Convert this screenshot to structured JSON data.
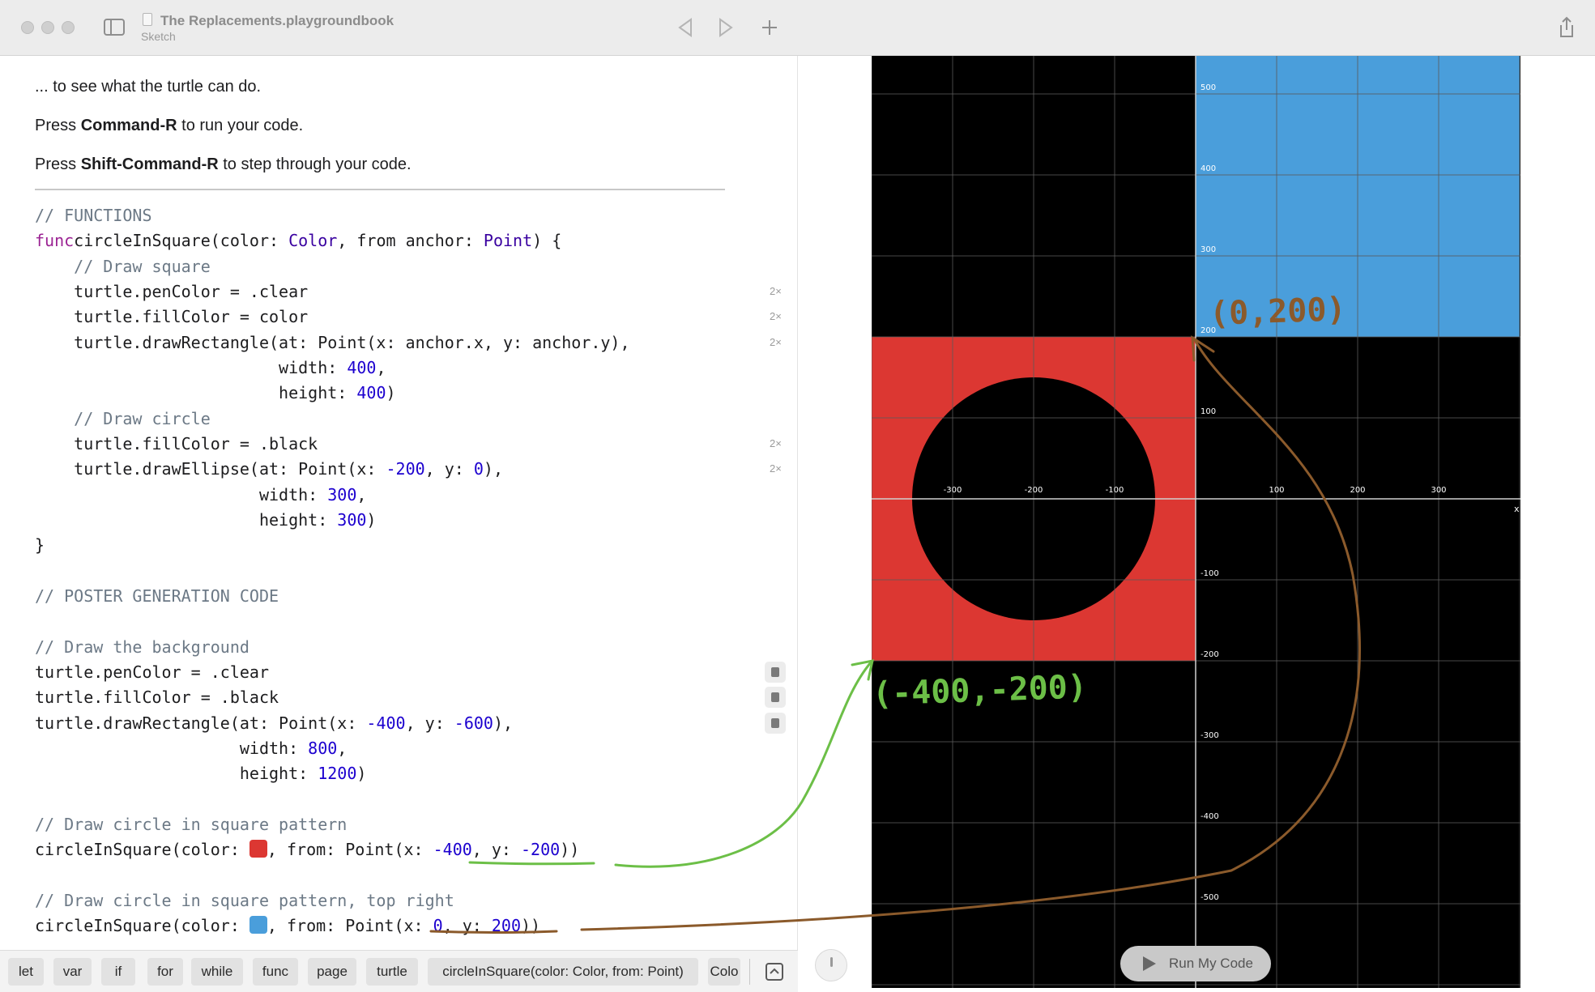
{
  "window": {
    "title": "The Replacements.playgroundbook",
    "subtitle": "Sketch"
  },
  "prose": {
    "line1": "... to see what the turtle can do.",
    "line2_pre": "Press ",
    "line2_bold": "Command-R",
    "line2_post": " to run your code.",
    "line3_pre": "Press ",
    "line3_bold": "Shift-Command-R",
    "line3_post": " to step through your code."
  },
  "code": [
    [
      [
        "cm",
        "// FUNCTIONS"
      ]
    ],
    [
      [
        "kw",
        "func"
      ],
      [
        "",
        "circleInSquare(color: "
      ],
      [
        "ty",
        "Color"
      ],
      [
        "",
        ", from anchor: "
      ],
      [
        "ty",
        "Point"
      ],
      [
        "",
        ") {"
      ]
    ],
    [
      [
        "",
        "    "
      ],
      [
        "cm",
        "// Draw square"
      ]
    ],
    [
      [
        "",
        "    turtle.penColor = .clear"
      ]
    ],
    [
      [
        "",
        "    turtle.fillColor = color"
      ]
    ],
    [
      [
        "",
        "    turtle.drawRectangle(at: Point(x: anchor.x, y: anchor.y),"
      ]
    ],
    [
      [
        "",
        "                         width: "
      ],
      [
        "nu",
        "400"
      ],
      [
        "",
        ","
      ]
    ],
    [
      [
        "",
        "                         height: "
      ],
      [
        "nu",
        "400"
      ],
      [
        "",
        ")"
      ]
    ],
    [
      [
        "",
        "    "
      ],
      [
        "cm",
        "// Draw circle"
      ]
    ],
    [
      [
        "",
        "    turtle.fillColor = .black"
      ]
    ],
    [
      [
        "",
        "    turtle.drawEllipse(at: Point(x: "
      ],
      [
        "nu",
        "-200"
      ],
      [
        "",
        ", y: "
      ],
      [
        "nu",
        "0"
      ],
      [
        "",
        "),"
      ]
    ],
    [
      [
        "",
        "                       width: "
      ],
      [
        "nu",
        "300"
      ],
      [
        "",
        ","
      ]
    ],
    [
      [
        "",
        "                       height: "
      ],
      [
        "nu",
        "300"
      ],
      [
        "",
        ")"
      ]
    ],
    [
      [
        "",
        "}"
      ]
    ],
    [
      [
        "",
        ""
      ]
    ],
    [
      [
        "cm",
        "// POSTER GENERATION CODE"
      ]
    ],
    [
      [
        "",
        ""
      ]
    ],
    [
      [
        "cm",
        "// Draw the background"
      ]
    ],
    [
      [
        "",
        "turtle.penColor = .clear"
      ]
    ],
    [
      [
        "",
        "turtle.fillColor = .black"
      ]
    ],
    [
      [
        "",
        "turtle.drawRectangle(at: Point(x: "
      ],
      [
        "nu",
        "-400"
      ],
      [
        "",
        ", y: "
      ],
      [
        "nu",
        "-600"
      ],
      [
        "",
        "),"
      ]
    ],
    [
      [
        "",
        "                     width: "
      ],
      [
        "nu",
        "800"
      ],
      [
        "",
        ","
      ]
    ],
    [
      [
        "",
        "                     height: "
      ],
      [
        "nu",
        "1200"
      ],
      [
        "",
        ")"
      ]
    ],
    [
      [
        "",
        ""
      ]
    ],
    [
      [
        "cm",
        "// Draw circle in square pattern"
      ]
    ],
    [
      [
        "",
        "circleInSquare(color: "
      ],
      [
        "swatch",
        "#dc3732"
      ],
      [
        "",
        ", from: Point(x: "
      ],
      [
        "nu",
        "-400"
      ],
      [
        "",
        ", y: "
      ],
      [
        "nu",
        "-200"
      ],
      [
        "",
        "))"
      ]
    ],
    [
      [
        "",
        ""
      ]
    ],
    [
      [
        "cm",
        "// Draw circle in square pattern, top right"
      ]
    ],
    [
      [
        "",
        "circleInSquare(color: "
      ],
      [
        "swatch",
        "#4a9edb"
      ],
      [
        "",
        ", from: Point(x: "
      ],
      [
        "nu",
        "0"
      ],
      [
        "",
        ", y: "
      ],
      [
        "nu",
        "200"
      ],
      [
        "",
        "))"
      ]
    ]
  ],
  "gutter_badges": [
    {
      "line": 3,
      "text": "2×"
    },
    {
      "line": 4,
      "text": "2×"
    },
    {
      "line": 5,
      "text": "2×"
    },
    {
      "line": 9,
      "text": "2×"
    },
    {
      "line": 10,
      "text": "2×"
    }
  ],
  "gutter_cubes": [
    18,
    19,
    20
  ],
  "tokens": [
    "let",
    "var",
    "if",
    "for",
    "while",
    "func",
    "page",
    "turtle",
    "circleInSquare(color: Color, from: Point)",
    "Colo"
  ],
  "liveview": {
    "run_label": "Run My Code",
    "x_ticks": [
      "-300",
      "-200",
      "-100",
      "100",
      "200",
      "300"
    ],
    "y_ticks": [
      "500",
      "400",
      "300",
      "200",
      "100",
      "-100",
      "-200",
      "-300",
      "-400",
      "-500"
    ],
    "x_axis_label": "x",
    "colors": {
      "background": "#000000",
      "red": "#dc3732",
      "blue": "#4a9edb",
      "grid": "#5a5a5a"
    }
  },
  "annotations": {
    "top_right": "(0,200)",
    "bottom_left": "(-400,-200)",
    "brown": "#8b5a2b",
    "green": "#6cbf47"
  },
  "colors": {
    "comment": "#6c7986",
    "keyword": "#9b2393",
    "type": "#3900a0",
    "number": "#1c00cf"
  }
}
